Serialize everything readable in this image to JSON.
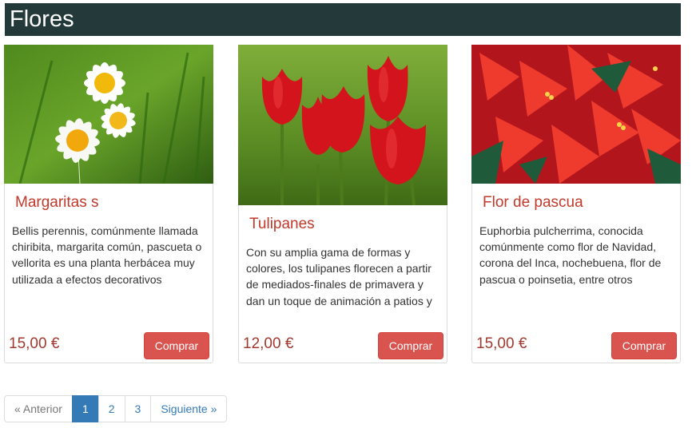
{
  "page": {
    "title": "Flores"
  },
  "products": [
    {
      "title": "Margaritas s",
      "description": "Bellis perennis, comúnmente llamada chiribita, margarita común, pascueta o vellorita es una planta herbácea muy utilizada a efectos decorativos",
      "price": "15,00 €",
      "button_label": "Comprar",
      "image": "daisies-photo"
    },
    {
      "title": "Tulipanes",
      "description": "Con su amplia gama de formas y colores, los tulipanes florecen a partir de mediados-finales de primavera y dan un toque de animación a patios y",
      "price": "12,00 €",
      "button_label": "Comprar",
      "image": "tulips-photo"
    },
    {
      "title": "Flor de pascua",
      "description": "Euphorbia pulcherrima, conocida comúnmente como flor de Navidad, corona del Inca, nochebuena, flor de pascua o poinsetia, entre otros",
      "price": "15,00 €",
      "button_label": "Comprar",
      "image": "poinsettia-photo"
    }
  ],
  "pagination": {
    "prev_label": "« Anterior",
    "pages": [
      "1",
      "2",
      "3"
    ],
    "active_page": "1",
    "next_label": "Siguiente »"
  },
  "colors": {
    "header_bg": "#243a3a",
    "accent_red": "#d9534f",
    "title_red": "#c0392b",
    "link_blue": "#337ab7"
  }
}
